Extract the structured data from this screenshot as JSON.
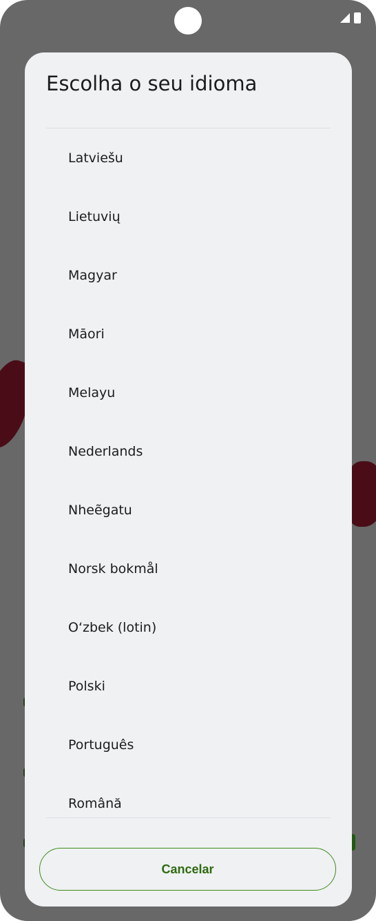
{
  "dialog": {
    "title": "Escolha o seu idioma",
    "languages": [
      "Latviešu",
      "Lietuvių",
      "Magyar",
      "Māori",
      "Melayu",
      "Nederlands",
      "Nheẽgatu",
      "Norsk bokmål",
      "O‘zbek (lotin)",
      "Polski",
      "Português",
      "Română"
    ],
    "cancel_label": "Cancelar"
  },
  "colors": {
    "accent": "#3f8a1a",
    "dialog_bg": "#eff1f3",
    "scrim": "#686868"
  },
  "status_bar": {
    "icons": [
      "signal-icon",
      "battery-icon"
    ]
  }
}
